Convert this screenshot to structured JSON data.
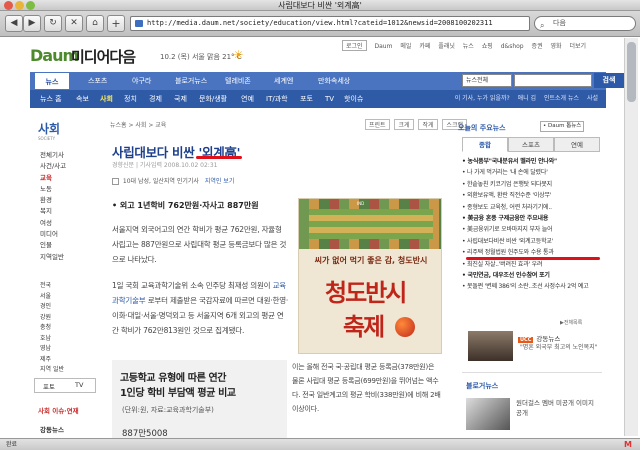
{
  "window": {
    "title": "사립대보다 비싼 '외계高'"
  },
  "toolbar": {
    "back": "◀",
    "forward": "▶",
    "reload": "↻",
    "stop": "✕",
    "home": "⌂",
    "add": "+",
    "url": "http://media.daum.net/society/education/view.html?cateid=1012&newsid=2008100202311",
    "search_value": "다음"
  },
  "header": {
    "login": "로그인",
    "util_links": [
      "Daum",
      "메일",
      "카페",
      "플래닛",
      "뉴스",
      "쇼핑",
      "d&shop",
      "증권",
      "영화",
      "더보기"
    ],
    "logo": "Daum",
    "logo_sub": "미디어다음",
    "weather": "10.2 (목) 서울 맑음 21° C"
  },
  "nav1": {
    "items": [
      "뉴스",
      "스포츠",
      "야구라",
      "블로거뉴스",
      "텔레비존",
      "세계엔",
      "만화속세상"
    ],
    "search_select": "뉴스전체",
    "search_button": "검색"
  },
  "nav2": {
    "items": [
      "뉴스 홈",
      "속보",
      "사회",
      "정치",
      "경제",
      "국제",
      "문화/생활",
      "연예",
      "IT/과학",
      "포토",
      "TV",
      "핫이슈"
    ],
    "active": 2,
    "right_links": [
      "이 기사, 누가 읽을까?",
      "애니 김",
      "인트소개 뉴스",
      "사설"
    ]
  },
  "sidebar": {
    "title": "사회",
    "title_en": "SOCIETY",
    "items": [
      "전체기사",
      "사건/사고",
      "교육",
      "노동",
      "환경",
      "복지",
      "여성",
      "미디어",
      "인물",
      "지역일반"
    ],
    "active": 2,
    "regions": [
      "전국",
      "서울",
      "경인",
      "강원",
      "충청",
      "호남",
      "영남",
      "제주",
      "지역 일반"
    ],
    "tabs": [
      "포토",
      "TV"
    ],
    "foot1": "사회 이슈·연재",
    "foot2": "강동뉴스"
  },
  "article": {
    "breadcrumb": "뉴스홈 > 사회 > 교육",
    "tools": [
      "프린트",
      "크게",
      "작게",
      "스크랩"
    ],
    "title": "사립대보다 비싼 '외계高'",
    "byline": "경향신문 | 기사입력 2008.10.02 02:31",
    "meta": "10대 남성, 일산지역 인기기사",
    "meta_link": "지역인 보기",
    "lead": "• 외고 1년학비 762만원·자사고 887만원",
    "para1": "서울지역 외국어고의 연간 학비가 평균 762만원, 자율형 사립고는 887만원으로 사립대학 평균 등록금보다 많은 것으로 나타났다.",
    "para2_pre": "1일 국회 교육과학기술위 소속 민주당 최재성 의원이",
    "para2_link": "교육과학기술부",
    "para2_post": "로부터 제출받은 국감자료에 따르면 대원·한영·이화·대일·서울·명덕외고 등 서울지역 6개 외고의 평균 연간 학비가 762만813원인 것으로 집계됐다.",
    "para3": "이는 올해 전국 국·공립대 평균 등록금(378만원)은 물론 사립대 평균 등록금(699만원)을 뛰어넘는 액수다. 전국 일반계고의 평균 학비(338만원)에 비해 2배 이상이다.",
    "ad": {
      "tag": "IND",
      "slogan": "씨가 없어 먹기 좋은 감, 청도반시",
      "big1": "청도반시",
      "big2": "축제"
    },
    "box": {
      "title_line1": "고등학교 유형에 따른 연간",
      "title_line2": "1인당 학비 부담액 평균 비교",
      "unit": "(단위:원, 자료:교육과학기술부)",
      "value": "887만5008"
    }
  },
  "right": {
    "heading": "오늘의 주요뉴스",
    "select": "• Daum 톱뉴스",
    "tabs": [
      "종합",
      "스포츠",
      "연예"
    ],
    "active_tab": 0,
    "news": [
      "• 농식품부\"국내분유서 멜라민 안나와\"",
      "• 나 가게 먹거리는 '내 손에 달렸다'",
      "• 한솥놓친 키코기업 은행탓 되다못지",
      "• 외환보유액, 환란 직전수준 '이상무'",
      "• 종형보도 교육청, 어련 처라기기에..",
      "• 美금융 혼풍 구제금융안 주요내용",
      "• 美금융위기로 오바마지지 부자 늘어",
      "• 사립대보다비싼 비싼 '외계고등학교'",
      "• 리주택 정월법원 헌주도와 수용 통과",
      "• 최진실 자살..'버려진 효과' 우려",
      "• 국민연금, 대우조선 인수참여 포기",
      "• 못돌쩐 '변쩨 386'의 소란..조선 사정수사 2억 예고"
    ],
    "more": "▶전체목록",
    "promo1_badge": "UCC",
    "promo1_name": "강동뉴스",
    "promo1_desc": "\"명혼 외국부 최고의 노인복지\"",
    "heading2": "블로거뉴스",
    "promo2_desc": "원더걸스 멤버 미공개 이미지 공개"
  },
  "status": {
    "text": "완료"
  }
}
